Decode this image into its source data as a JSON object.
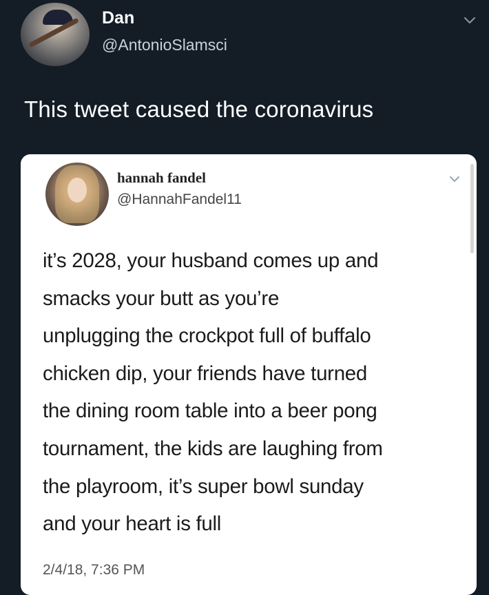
{
  "outer_tweet": {
    "name": "Dan",
    "handle": "@AntonioSlamsci",
    "text": "This tweet caused the coronavirus",
    "avatar_icon": "baseball-player-avatar",
    "menu_icon": "chevron-down-icon"
  },
  "quoted_tweet": {
    "name": "hannah fandel",
    "handle": "@HannahFandel11",
    "text_lines": [
      "it’s 2028, your husband comes up and",
      "smacks your butt as you’re",
      "unplugging the crockpot full of buffalo",
      "chicken dip, your friends have turned",
      "the dining room table into a beer pong",
      "tournament, the kids are laughing from",
      "the playroom, it’s super bowl sunday",
      "and your heart is full"
    ],
    "timestamp": "2/4/18, 7:36 PM",
    "avatar_icon": "profile-photo-avatar",
    "menu_icon": "chevron-down-icon"
  },
  "colors": {
    "background": "#141d26",
    "card": "#ffffff",
    "outer_text": "#ffffff",
    "inner_text": "#1b1b1b"
  }
}
